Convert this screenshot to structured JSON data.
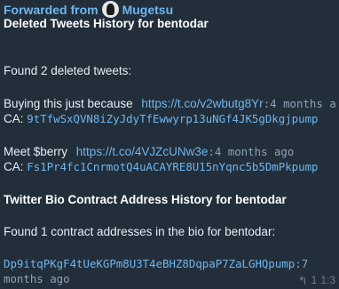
{
  "forwarded": {
    "prefix": "Forwarded from",
    "source": "Mugetsu"
  },
  "title": "Deleted Tweets History for bentodar",
  "summary": "Found 2 deleted tweets:",
  "tweets": [
    {
      "text": "Buying this just because",
      "link": "https://t.co/v2wbutg8Yr",
      "age": ":4 months a",
      "ca_label": "CA:",
      "ca": "9tTfwSxQVN8iZyJdyTfEwwyrp13uNGf4JK5gDkgjpump"
    },
    {
      "text": "Meet $berry",
      "link": "https://t.co/4VJZcUNw3e",
      "age": ":4 months ago",
      "ca_label": "CA:",
      "ca": "Fs1Pr4fc1CnrmotQ4uACAYRE8U15nYqnc5b5DmPkpump"
    }
  ],
  "bio_title": "Twitter Bio Contract Address History for bentodar",
  "bio_summary": "Found 1 contract addresses in the bio for bentodar:",
  "bio_entry": {
    "address": "Dp9itqPKgF4tUeKGPm8U3T4eBHZ8DqpaP7ZaLGHQpump",
    "age_start": ":7",
    "age_end": "months ago"
  },
  "footer": {
    "reply_count": "1",
    "time": "1:3"
  }
}
